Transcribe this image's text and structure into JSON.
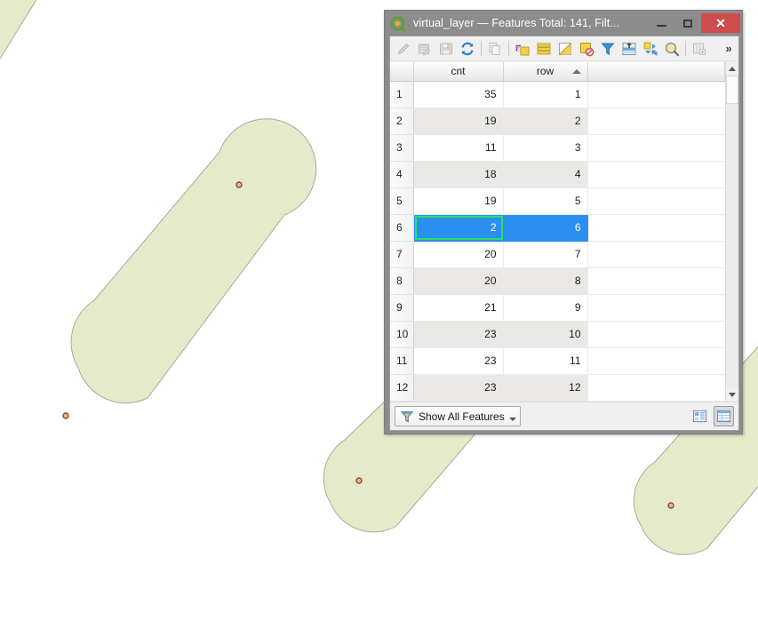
{
  "window": {
    "title": "virtual_layer — Features Total: 141, Filt...",
    "logo_icon": "qgis-logo-icon",
    "minimize_label": "minimize",
    "maximize_label": "maximize",
    "close_label": "✕",
    "close_color": "#cf4c4c",
    "titlebar_color": "#8c8c8c"
  },
  "toolbar": {
    "overflow_label": "»",
    "buttons": [
      {
        "name": "toggle-editing-icon",
        "title": "Toggle editing mode",
        "enabled": false
      },
      {
        "name": "save-edits-icon",
        "title": "Save edits",
        "enabled": false
      },
      {
        "name": "save-layer-icon",
        "title": "Save layer edits",
        "enabled": false
      },
      {
        "name": "reload-table-icon",
        "title": "Reload the table",
        "enabled": true
      },
      {
        "name": "copy-features-icon",
        "title": "Copy selected rows",
        "enabled": false
      },
      {
        "name": "select-by-expression-icon",
        "title": "Select features using an expression",
        "enabled": true
      },
      {
        "name": "select-all-icon",
        "title": "Select all features",
        "enabled": true
      },
      {
        "name": "invert-selection-icon",
        "title": "Invert selection",
        "enabled": true
      },
      {
        "name": "deselect-all-icon",
        "title": "Deselect all features",
        "enabled": true
      },
      {
        "name": "filter-selection-icon",
        "title": "Filter / select features",
        "enabled": true
      },
      {
        "name": "move-selection-top-icon",
        "title": "Move selection to top",
        "enabled": true
      },
      {
        "name": "pan-to-selection-icon",
        "title": "Pan map to selected rows",
        "enabled": true
      },
      {
        "name": "zoom-to-selection-icon",
        "title": "Zoom map to selected rows",
        "enabled": true
      },
      {
        "name": "new-field-icon",
        "title": "New field",
        "enabled": false
      }
    ]
  },
  "table": {
    "columns": [
      {
        "key": "rownum",
        "label": "",
        "sorted": false
      },
      {
        "key": "cnt",
        "label": "cnt",
        "sorted": false
      },
      {
        "key": "row",
        "label": "row",
        "sorted": true,
        "sort_direction": "asc"
      }
    ],
    "rows": [
      {
        "num": "1",
        "cnt": "35",
        "row": "1",
        "selected": false
      },
      {
        "num": "2",
        "cnt": "19",
        "row": "2",
        "selected": false
      },
      {
        "num": "3",
        "cnt": "11",
        "row": "3",
        "selected": false
      },
      {
        "num": "4",
        "cnt": "18",
        "row": "4",
        "selected": false
      },
      {
        "num": "5",
        "cnt": "19",
        "row": "5",
        "selected": false
      },
      {
        "num": "6",
        "cnt": "2",
        "row": "6",
        "selected": true
      },
      {
        "num": "7",
        "cnt": "20",
        "row": "7",
        "selected": false
      },
      {
        "num": "8",
        "cnt": "20",
        "row": "8",
        "selected": false
      },
      {
        "num": "9",
        "cnt": "21",
        "row": "9",
        "selected": false
      },
      {
        "num": "10",
        "cnt": "23",
        "row": "10",
        "selected": false
      },
      {
        "num": "11",
        "cnt": "23",
        "row": "11",
        "selected": false
      },
      {
        "num": "12",
        "cnt": "23",
        "row": "12",
        "selected": false
      }
    ],
    "selection_color": "#2a8fee",
    "focus_ring_color": "#22e06a",
    "alt_row_color": "#e9e8e4"
  },
  "bottom_bar": {
    "filter_label": "Show All Features",
    "filter_icon": "funnel-icon",
    "form_view_label": "form-view",
    "table_view_label": "table-view",
    "active_view": "table-view"
  },
  "map": {
    "polygon_fill": "#e5eacb",
    "polygon_stroke": "#a9a99a",
    "point_fill": "#e8b888",
    "point_stroke": "#8a4a30",
    "background": "#ffffff"
  }
}
